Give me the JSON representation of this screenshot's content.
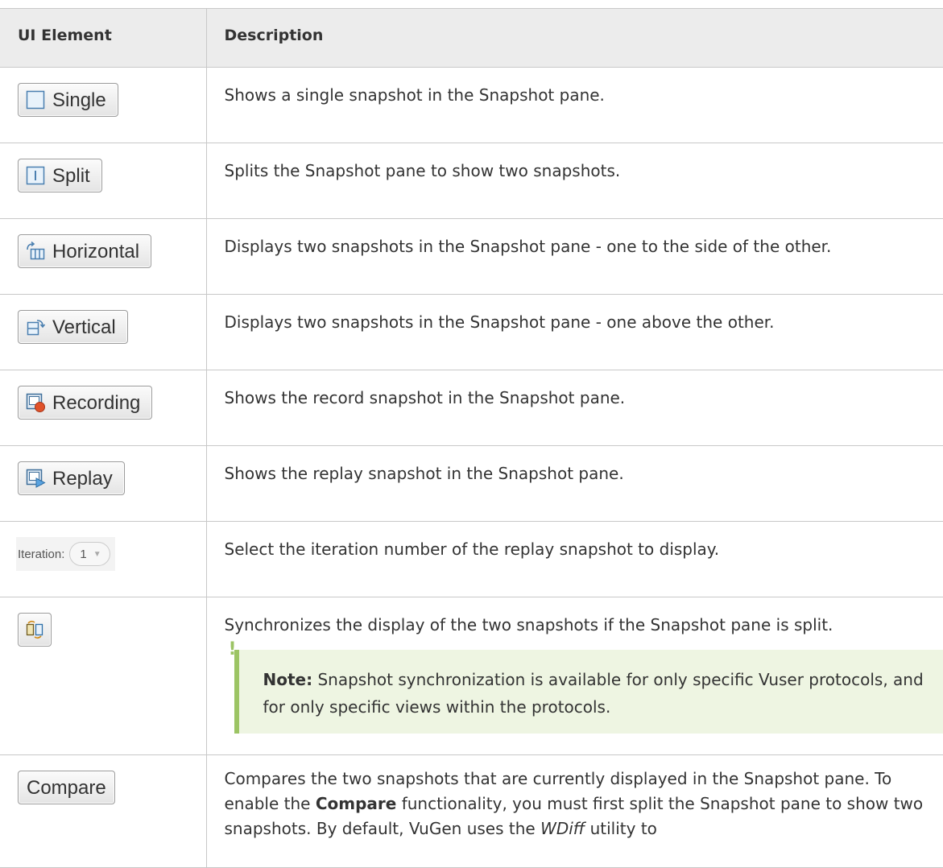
{
  "table": {
    "headers": [
      "UI Element",
      "Description"
    ],
    "rows": [
      {
        "button_label": "Single",
        "icon": "single-pane-icon",
        "description": "Shows a single snapshot in the Snapshot pane."
      },
      {
        "button_label": "Split",
        "icon": "split-pane-icon",
        "description": "Splits the Snapshot pane to show two snapshots."
      },
      {
        "button_label": "Horizontal",
        "icon": "horizontal-layout-icon",
        "description": "Displays two snapshots in the Snapshot pane - one to the side of the other."
      },
      {
        "button_label": "Vertical",
        "icon": "vertical-layout-icon",
        "description": "Displays two snapshots in the Snapshot pane - one above the other."
      },
      {
        "button_label": "Recording",
        "icon": "record-snapshot-icon",
        "description": "Shows the record snapshot in the Snapshot pane."
      },
      {
        "button_label": "Replay",
        "icon": "replay-snapshot-icon",
        "description": "Shows the replay snapshot in the Snapshot pane."
      },
      {
        "iteration_label": "Iteration:",
        "iteration_value": "1",
        "description": "Select the iteration number of the replay snapshot to display."
      },
      {
        "icon": "synchronize-icon",
        "description": "Synchronizes the display of the two snapshots if the Snapshot pane is split.",
        "note_label": "Note:",
        "note_text": " Snapshot synchronization is available for only specific Vuser protocols, and for only specific views within the protocols.",
        "note_icon": "note-exclamation-icon"
      },
      {
        "button_label": "Compare",
        "description_parts": [
          "Compares the two snapshots that are currently displayed in the Snapshot pane. To enable the ",
          "Compare",
          " functionality, you must first split the Snapshot pane to show two snapshots. By default, VuGen uses the ",
          "WDiff",
          " utility to"
        ]
      }
    ]
  }
}
